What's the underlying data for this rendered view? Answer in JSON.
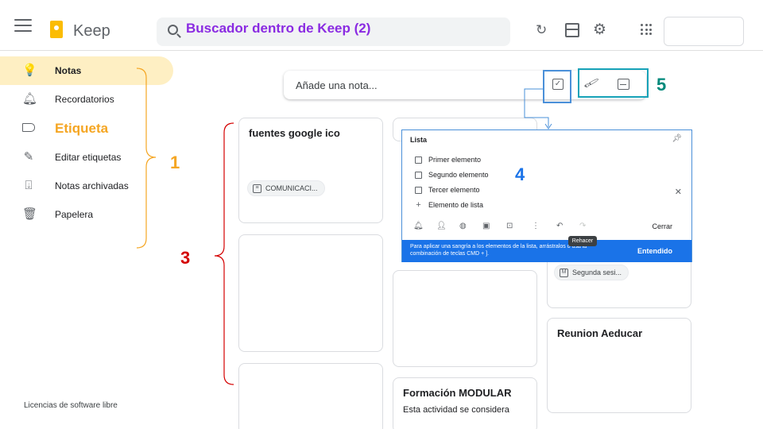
{
  "header": {
    "app_name": "Keep",
    "search_label": "Buscador dentro de Keep (2)"
  },
  "sidebar": {
    "items": [
      {
        "label": "Notas",
        "icon": "lightbulb-icon",
        "active": true
      },
      {
        "label": "Recordatorios",
        "icon": "bell-icon"
      },
      {
        "label": "Etiqueta",
        "icon": "label-icon"
      },
      {
        "label": "Editar etiquetas",
        "icon": "pencil-icon"
      },
      {
        "label": "Notas archivadas",
        "icon": "archive-icon"
      },
      {
        "label": "Papelera",
        "icon": "trash-icon"
      }
    ],
    "footer": "Licencias de software libre"
  },
  "take_note": {
    "placeholder": "Añade una nota..."
  },
  "annotations": {
    "n1": "1",
    "n3": "3",
    "n4": "4",
    "n5": "5"
  },
  "cards": {
    "fuentes": {
      "title": "fuentes google ico",
      "chip": "COMUNICACI..."
    },
    "sesion_chip": "Segunda sesi...",
    "reunion": {
      "title": "Reunion Aeducar"
    },
    "formacion": {
      "title": "Formación MODULAR",
      "text": "Esta actividad se considera"
    }
  },
  "list_popup": {
    "title": "Lista",
    "items": [
      "Primer elemento",
      "Segundo elemento",
      "Tercer elemento"
    ],
    "add_item": "Elemento de lista",
    "close_label": "Cerrar",
    "tooltip": "Rehacer",
    "banner_text": "Para aplicar una sangría a los elementos de la lista, arrástralos o usa la combinación de teclas CMD + ].",
    "banner_button": "Entendido"
  },
  "colors": {
    "annotation_orange": "#f5a623",
    "annotation_red": "#d40000",
    "annotation_blue": "#1a73e8",
    "annotation_teal": "#00897b",
    "search_label_purple": "#8a2be2",
    "active_nav": "#feefc3"
  }
}
